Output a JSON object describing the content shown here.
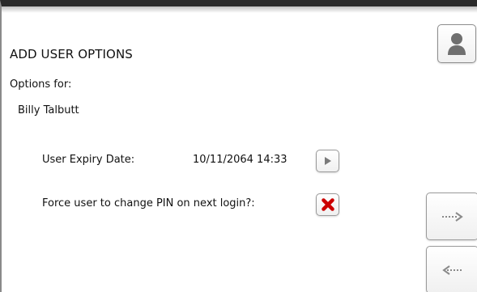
{
  "screen": {
    "title": "ADD USER OPTIONS",
    "options_for_label": "Options for:",
    "user_name": "Billy Talbutt"
  },
  "fields": {
    "expiry": {
      "label": "User Expiry Date:",
      "value": "10/11/2064 14:33"
    },
    "force_pin_change": {
      "label": "Force user to change PIN on next login?:",
      "checked": false
    }
  },
  "icons": {
    "user": "user-icon",
    "play": "play-icon",
    "toggle_off": "red-x-icon",
    "next": "dotted-right-arrow-icon",
    "back": "dotted-left-arrow-icon"
  },
  "colors": {
    "accent_red": "#cc0000",
    "icon_gray": "#6f6f6f",
    "text": "#111111"
  }
}
